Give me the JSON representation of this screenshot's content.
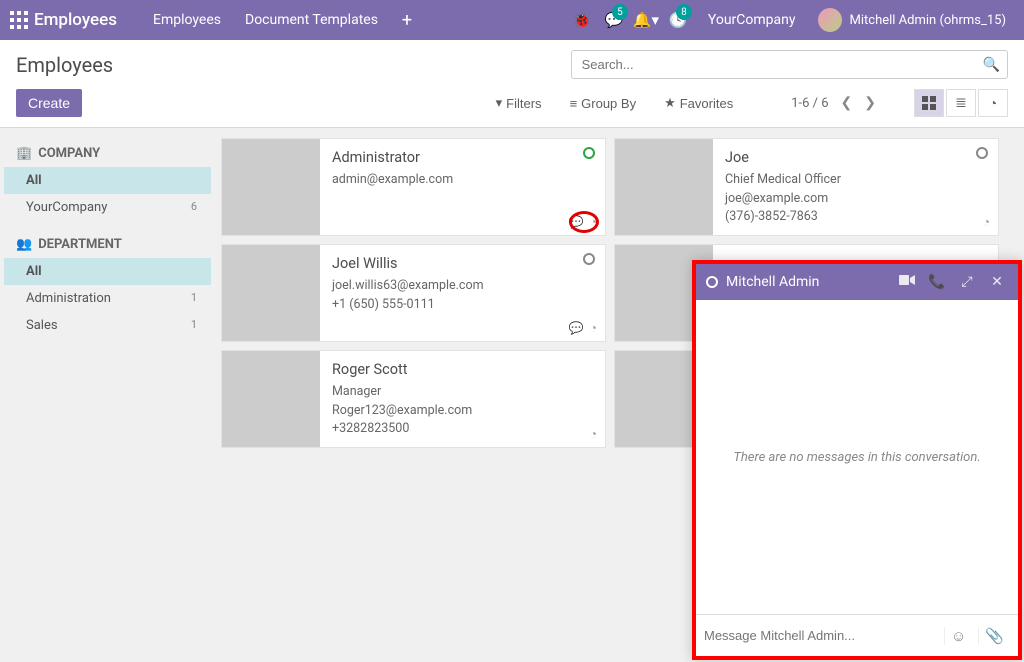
{
  "navbar": {
    "brand": "Employees",
    "menu": [
      "Employees",
      "Document Templates"
    ],
    "messaging_badge": "5",
    "activity_badge": "8",
    "company": "YourCompany",
    "user": "Mitchell Admin (ohrms_15)"
  },
  "page": {
    "title": "Employees",
    "search_placeholder": "Search...",
    "create_label": "Create",
    "filters_label": "Filters",
    "groupby_label": "Group By",
    "favorites_label": "Favorites",
    "pager": "1-6 / 6"
  },
  "sidebar": {
    "company_label": "COMPANY",
    "department_label": "DEPARTMENT",
    "all_label": "All",
    "company_items": [
      {
        "name": "YourCompany",
        "count": "6"
      }
    ],
    "dept_items": [
      {
        "name": "Administration",
        "count": "1"
      },
      {
        "name": "Sales",
        "count": "1"
      }
    ]
  },
  "employees": [
    {
      "name": "Administrator",
      "title": "",
      "email": "admin@example.com",
      "phone": "",
      "presence": "online",
      "photo": "ph1",
      "chat": true
    },
    {
      "name": "Joe",
      "title": "Chief Medical Officer",
      "email": "joe@example.com",
      "phone": "(376)-3852-7863",
      "presence": "offline",
      "photo": "ph2"
    },
    {
      "name": "Joel Willis",
      "title": "",
      "email": "joel.willis63@example.com",
      "phone": "+1 (650) 555-0111",
      "presence": "offline",
      "photo": "ph3",
      "chat": true
    },
    {
      "name": "",
      "title": "",
      "email": "",
      "phone": "",
      "presence": "offline",
      "photo": "ph4",
      "obscured": true
    },
    {
      "name": "Roger Scott",
      "title": "Manager",
      "email": "Roger123@example.com",
      "phone": "+3282823500",
      "presence": "",
      "photo": "ph5"
    },
    {
      "name": "",
      "title": "",
      "email": "",
      "phone": "",
      "presence": "",
      "photo": "ph6",
      "obscured": true
    }
  ],
  "chat": {
    "title": "Mitchell Admin",
    "empty_message": "There are no messages in this conversation.",
    "input_placeholder": "Message Mitchell Admin..."
  }
}
